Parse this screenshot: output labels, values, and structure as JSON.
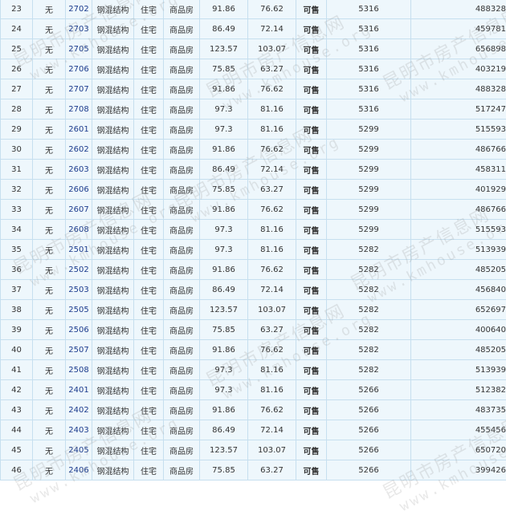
{
  "rows": [
    {
      "no": "23",
      "floor_tag": "无",
      "room": "2702",
      "structure": "钢混结构",
      "use": "住宅",
      "type": "商品房",
      "area": "91.86",
      "inner_area": "76.62",
      "status": "可售",
      "price": "5316",
      "total": "488328"
    },
    {
      "no": "24",
      "floor_tag": "无",
      "room": "2703",
      "structure": "钢混结构",
      "use": "住宅",
      "type": "商品房",
      "area": "86.49",
      "inner_area": "72.14",
      "status": "可售",
      "price": "5316",
      "total": "459781"
    },
    {
      "no": "25",
      "floor_tag": "无",
      "room": "2705",
      "structure": "钢混结构",
      "use": "住宅",
      "type": "商品房",
      "area": "123.57",
      "inner_area": "103.07",
      "status": "可售",
      "price": "5316",
      "total": "656898"
    },
    {
      "no": "26",
      "floor_tag": "无",
      "room": "2706",
      "structure": "钢混结构",
      "use": "住宅",
      "type": "商品房",
      "area": "75.85",
      "inner_area": "63.27",
      "status": "可售",
      "price": "5316",
      "total": "403219"
    },
    {
      "no": "27",
      "floor_tag": "无",
      "room": "2707",
      "structure": "钢混结构",
      "use": "住宅",
      "type": "商品房",
      "area": "91.86",
      "inner_area": "76.62",
      "status": "可售",
      "price": "5316",
      "total": "488328"
    },
    {
      "no": "28",
      "floor_tag": "无",
      "room": "2708",
      "structure": "钢混结构",
      "use": "住宅",
      "type": "商品房",
      "area": "97.3",
      "inner_area": "81.16",
      "status": "可售",
      "price": "5316",
      "total": "517247"
    },
    {
      "no": "29",
      "floor_tag": "无",
      "room": "2601",
      "structure": "钢混结构",
      "use": "住宅",
      "type": "商品房",
      "area": "97.3",
      "inner_area": "81.16",
      "status": "可售",
      "price": "5299",
      "total": "515593"
    },
    {
      "no": "30",
      "floor_tag": "无",
      "room": "2602",
      "structure": "钢混结构",
      "use": "住宅",
      "type": "商品房",
      "area": "91.86",
      "inner_area": "76.62",
      "status": "可售",
      "price": "5299",
      "total": "486766"
    },
    {
      "no": "31",
      "floor_tag": "无",
      "room": "2603",
      "structure": "钢混结构",
      "use": "住宅",
      "type": "商品房",
      "area": "86.49",
      "inner_area": "72.14",
      "status": "可售",
      "price": "5299",
      "total": "458311"
    },
    {
      "no": "32",
      "floor_tag": "无",
      "room": "2606",
      "structure": "钢混结构",
      "use": "住宅",
      "type": "商品房",
      "area": "75.85",
      "inner_area": "63.27",
      "status": "可售",
      "price": "5299",
      "total": "401929"
    },
    {
      "no": "33",
      "floor_tag": "无",
      "room": "2607",
      "structure": "钢混结构",
      "use": "住宅",
      "type": "商品房",
      "area": "91.86",
      "inner_area": "76.62",
      "status": "可售",
      "price": "5299",
      "total": "486766"
    },
    {
      "no": "34",
      "floor_tag": "无",
      "room": "2608",
      "structure": "钢混结构",
      "use": "住宅",
      "type": "商品房",
      "area": "97.3",
      "inner_area": "81.16",
      "status": "可售",
      "price": "5299",
      "total": "515593"
    },
    {
      "no": "35",
      "floor_tag": "无",
      "room": "2501",
      "structure": "钢混结构",
      "use": "住宅",
      "type": "商品房",
      "area": "97.3",
      "inner_area": "81.16",
      "status": "可售",
      "price": "5282",
      "total": "513939"
    },
    {
      "no": "36",
      "floor_tag": "无",
      "room": "2502",
      "structure": "钢混结构",
      "use": "住宅",
      "type": "商品房",
      "area": "91.86",
      "inner_area": "76.62",
      "status": "可售",
      "price": "5282",
      "total": "485205"
    },
    {
      "no": "37",
      "floor_tag": "无",
      "room": "2503",
      "structure": "钢混结构",
      "use": "住宅",
      "type": "商品房",
      "area": "86.49",
      "inner_area": "72.14",
      "status": "可售",
      "price": "5282",
      "total": "456840"
    },
    {
      "no": "38",
      "floor_tag": "无",
      "room": "2505",
      "structure": "钢混结构",
      "use": "住宅",
      "type": "商品房",
      "area": "123.57",
      "inner_area": "103.07",
      "status": "可售",
      "price": "5282",
      "total": "652697"
    },
    {
      "no": "39",
      "floor_tag": "无",
      "room": "2506",
      "structure": "钢混结构",
      "use": "住宅",
      "type": "商品房",
      "area": "75.85",
      "inner_area": "63.27",
      "status": "可售",
      "price": "5282",
      "total": "400640"
    },
    {
      "no": "40",
      "floor_tag": "无",
      "room": "2507",
      "structure": "钢混结构",
      "use": "住宅",
      "type": "商品房",
      "area": "91.86",
      "inner_area": "76.62",
      "status": "可售",
      "price": "5282",
      "total": "485205"
    },
    {
      "no": "41",
      "floor_tag": "无",
      "room": "2508",
      "structure": "钢混结构",
      "use": "住宅",
      "type": "商品房",
      "area": "97.3",
      "inner_area": "81.16",
      "status": "可售",
      "price": "5282",
      "total": "513939"
    },
    {
      "no": "42",
      "floor_tag": "无",
      "room": "2401",
      "structure": "钢混结构",
      "use": "住宅",
      "type": "商品房",
      "area": "97.3",
      "inner_area": "81.16",
      "status": "可售",
      "price": "5266",
      "total": "512382"
    },
    {
      "no": "43",
      "floor_tag": "无",
      "room": "2402",
      "structure": "钢混结构",
      "use": "住宅",
      "type": "商品房",
      "area": "91.86",
      "inner_area": "76.62",
      "status": "可售",
      "price": "5266",
      "total": "483735"
    },
    {
      "no": "44",
      "floor_tag": "无",
      "room": "2403",
      "structure": "钢混结构",
      "use": "住宅",
      "type": "商品房",
      "area": "86.49",
      "inner_area": "72.14",
      "status": "可售",
      "price": "5266",
      "total": "455456"
    },
    {
      "no": "45",
      "floor_tag": "无",
      "room": "2405",
      "structure": "钢混结构",
      "use": "住宅",
      "type": "商品房",
      "area": "123.57",
      "inner_area": "103.07",
      "status": "可售",
      "price": "5266",
      "total": "650720"
    },
    {
      "no": "46",
      "floor_tag": "无",
      "room": "2406",
      "structure": "钢混结构",
      "use": "住宅",
      "type": "商品房",
      "area": "75.85",
      "inner_area": "63.27",
      "status": "可售",
      "price": "5266",
      "total": "399426"
    }
  ],
  "watermark": {
    "zh": "昆明市房产信息网",
    "en": "www.kmhouse.org"
  },
  "colors": {
    "row_bg": "#eef7fc",
    "border": "#c6dfef",
    "status_available": "#117a11",
    "room_link": "#1a3a8c"
  }
}
